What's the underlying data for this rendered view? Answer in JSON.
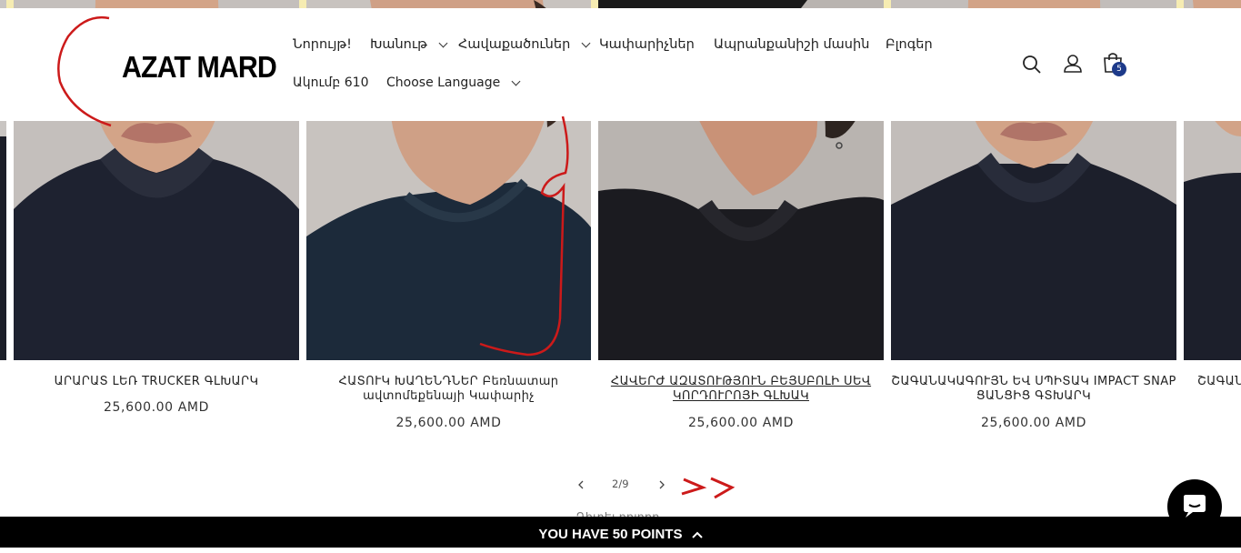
{
  "header": {
    "logo_text": "AZAT MARD",
    "nav": [
      {
        "label": "Նորույթ!",
        "has_dropdown": false
      },
      {
        "label": "Խանութ",
        "has_dropdown": true
      },
      {
        "label": "Հավաքածուներ",
        "has_dropdown": true
      },
      {
        "label": "Կափարիչներ",
        "has_dropdown": false
      },
      {
        "label": "Ապրանքանիշի մասին",
        "has_dropdown": false
      },
      {
        "label": "Բլոգեր",
        "has_dropdown": false
      },
      {
        "label": "Ակումբ 610",
        "has_dropdown": false
      },
      {
        "label": "Choose Language",
        "has_dropdown": true
      }
    ],
    "icons": [
      "search-icon",
      "account-icon",
      "cart-icon"
    ],
    "cart_count": "5"
  },
  "products": [
    {
      "title": "ԱՐԱՐԱՏ ԼԵՌ TRUCKER ԳԼԽԱՐԿ",
      "price": "25,600.00 AMD",
      "underlined": false
    },
    {
      "title": "ՀԱՏՈՒԿ ԽԱՂԵՆԴՆԵՐ Բեռնատար ավտոմեքենայի Կափարիչ",
      "price": "25,600.00 AMD",
      "underlined": false
    },
    {
      "title": "ՀԱՎԵՐԺ ԱԶԱՏՈՒԹՅՈՒՆ ԲԵՅՍԲՈԼԻ ՍԵՎ ԿՈՐԴՈՒՐՈՅԻ ԳԼԽԱԿ",
      "price": "25,600.00 AMD",
      "underlined": true
    },
    {
      "title": "ՇԱԳԱՆԱԿԱԳՈՒՅՆ ԵՎ ՍՊԻՏԱԿ IMPACT SNAP ՑԱՆՑԻՑ ԳՏԽԱՐԿ",
      "price": "25,600.00 AMD",
      "underlined": false
    },
    {
      "title": "ՇԱԳԱՆ",
      "price": "",
      "underlined": false
    }
  ],
  "pager": {
    "current": "2",
    "total": "9",
    "text": "2/9"
  },
  "behind_text": "Դիտել բոլորը",
  "points_bar": "YOU HAVE 50 POINTS",
  "colors": {
    "topbar": "#f6ecb2",
    "badge": "#1d3a8a",
    "annotation": "#cc1a1a",
    "shirt": "#1e2230",
    "backdrop": "#b8b4b1"
  }
}
